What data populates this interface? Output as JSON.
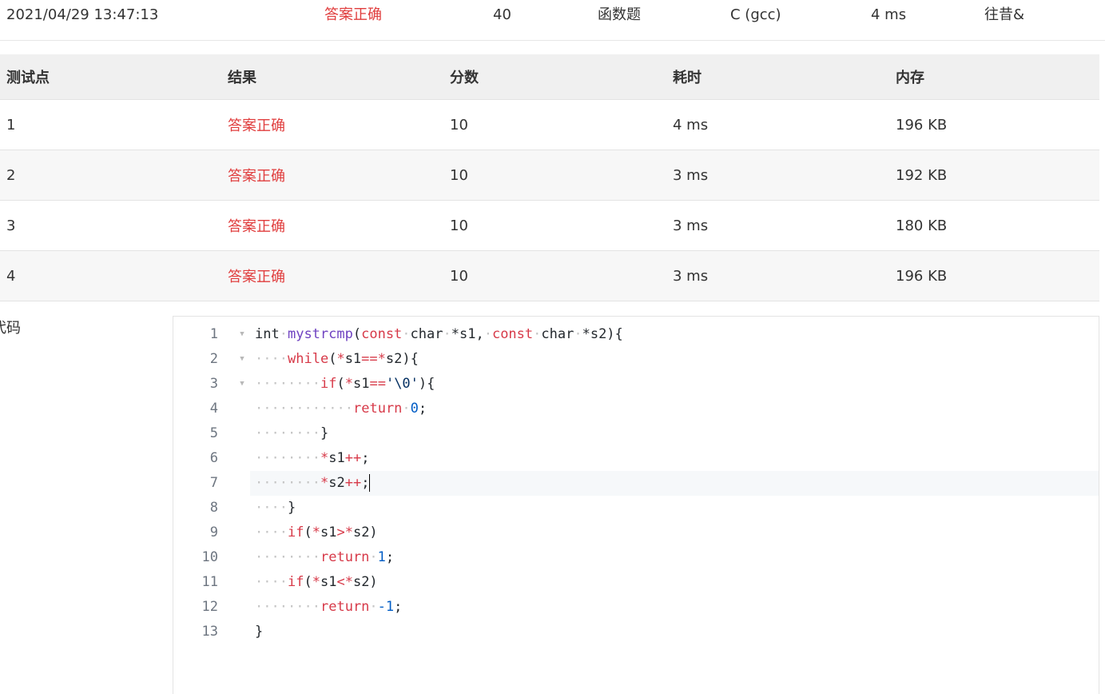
{
  "submission": {
    "time": "2021/04/29 13:47:13",
    "status": "答案正确",
    "score": "40",
    "problem_type": "函数题",
    "compiler": "C (gcc)",
    "cost": "4 ms",
    "user": "往昔&"
  },
  "cases": {
    "headers": [
      "测试点",
      "结果",
      "分数",
      "耗时",
      "内存"
    ],
    "rows": [
      {
        "id": "1",
        "result": "答案正确",
        "score": "10",
        "time": "4 ms",
        "memory": "196 KB"
      },
      {
        "id": "2",
        "result": "答案正确",
        "score": "10",
        "time": "3 ms",
        "memory": "192 KB"
      },
      {
        "id": "3",
        "result": "答案正确",
        "score": "10",
        "time": "3 ms",
        "memory": "180 KB"
      },
      {
        "id": "4",
        "result": "答案正确",
        "score": "10",
        "time": "3 ms",
        "memory": "196 KB"
      }
    ]
  },
  "code_section": {
    "label": "代码",
    "line_numbers": [
      "1",
      "2",
      "3",
      "4",
      "5",
      "6",
      "7",
      "8",
      "9",
      "10",
      "11",
      "12",
      "13"
    ],
    "fold_marker": "▼",
    "lines": [
      "int mystrcmp(const char *s1, const char *s2){",
      "    while(*s1==*s2){",
      "        if(*s1=='\\0'){",
      "            return 0;",
      "        }",
      "        *s1++;",
      "        *s2++;",
      "    }",
      "    if(*s1>*s2)",
      "        return 1;",
      "    if(*s1<*s2)",
      "        return -1;",
      "}"
    ]
  },
  "colors": {
    "accept": "#e03d3d",
    "keyword": "#d73a49",
    "function": "#6f42c1",
    "number": "#005cc5",
    "header_bg": "#f0f0f0"
  }
}
